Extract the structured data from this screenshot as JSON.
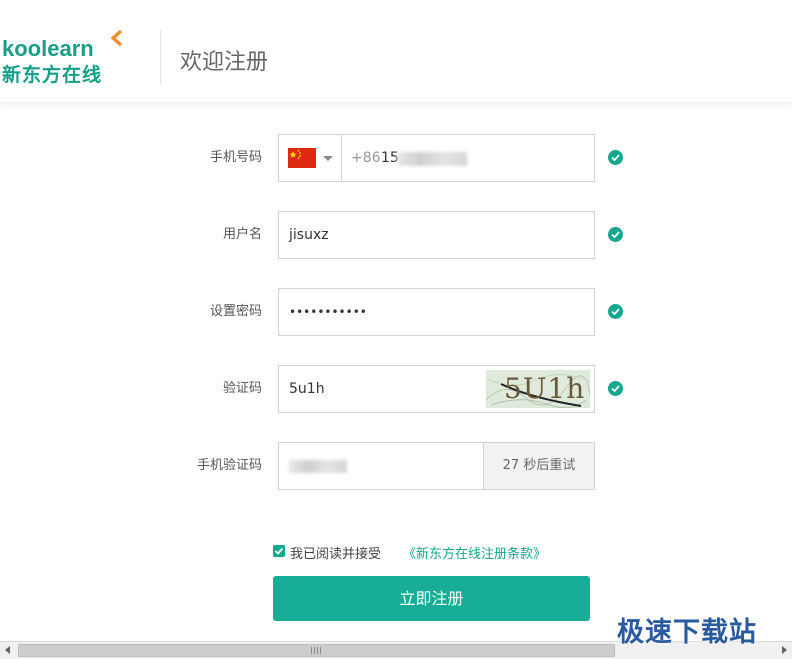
{
  "header": {
    "logo_en": "koolearn",
    "logo_cn": "新东方在线",
    "title": "欢迎注册"
  },
  "form": {
    "phone": {
      "label": "手机号码",
      "country_flag": "china-flag-icon",
      "prefix": "+86",
      "value_visible": "15"
    },
    "username": {
      "label": "用户名",
      "value": "jisuxz"
    },
    "password": {
      "label": "设置密码",
      "value": "•••••••••••"
    },
    "captcha": {
      "label": "验证码",
      "value": "5u1h",
      "image_text": "5U1h"
    },
    "sms_code": {
      "label": "手机验证码",
      "resend_button": "27 秒后重试"
    },
    "agreement": {
      "text": "我已阅读并接受",
      "link": "《新东方在线注册条款》",
      "checked": true
    },
    "submit_label": "立即注册"
  },
  "watermark": "极速下载站",
  "colors": {
    "brand": "#17ad97",
    "brand_orange": "#f08a24",
    "check": "#17a78f"
  }
}
